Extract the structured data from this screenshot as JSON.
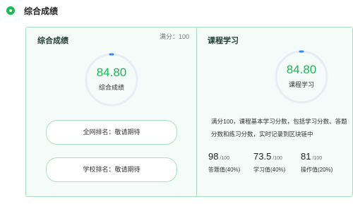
{
  "header": {
    "title": "综合成绩"
  },
  "overall": {
    "title": "综合成绩",
    "full_score": "满分：100",
    "score": "84.80",
    "score_label": "综合成绩",
    "progress": 0.848,
    "national_rank": "全网排名：敬请期待",
    "school_rank": "学校排名：敬请期待"
  },
  "course": {
    "title": "课程学习",
    "score": "84.80",
    "score_label": "课程学习",
    "progress": 0.848,
    "description": "满分100，课程基本学习分数，包括学习分数、答题分数和练习分数，实时记录到区块链中",
    "stats": [
      {
        "value": "98",
        "max": "/100",
        "label": "答题值(40%)"
      },
      {
        "value": "73.5",
        "max": "/100",
        "label": "学习值(40%)"
      },
      {
        "value": "81",
        "max": "/100",
        "label": "操作值(20%)"
      }
    ]
  },
  "colors": {
    "accent": "#19b955",
    "ring_track": "#e9ecf4",
    "ring_marker": "#2d8cf0",
    "border": "#a9e1bf"
  }
}
